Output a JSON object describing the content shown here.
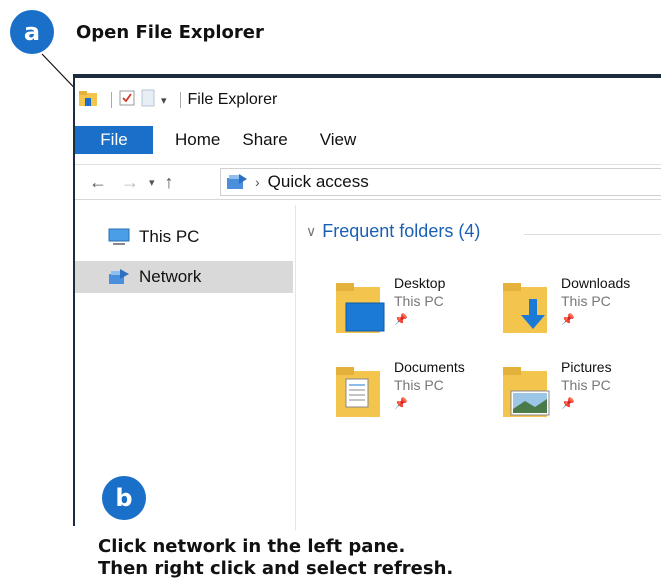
{
  "callout_a": {
    "letter": "a",
    "text": "Open File Explorer"
  },
  "callout_b": {
    "letter": "b",
    "text_line1": "Click network in the left pane.",
    "text_line2": "Then right click and select refresh."
  },
  "window": {
    "title": "File Explorer",
    "tabs": [
      "File",
      "Home",
      "Share",
      "View"
    ],
    "address": "Quick access"
  },
  "nav": {
    "items": [
      {
        "label": "This PC",
        "icon": "computer-icon"
      },
      {
        "label": "Network",
        "icon": "network-icon",
        "selected": true
      }
    ]
  },
  "content": {
    "group_title": "Frequent folders (4)",
    "folders": [
      {
        "name": "Desktop",
        "location": "This PC",
        "icon": "desktop-folder-icon"
      },
      {
        "name": "Downloads",
        "location": "This PC",
        "icon": "downloads-folder-icon"
      },
      {
        "name": "Documents",
        "location": "This PC",
        "icon": "documents-folder-icon"
      },
      {
        "name": "Pictures",
        "location": "This PC",
        "icon": "pictures-folder-icon"
      }
    ]
  },
  "colors": {
    "accent": "#1a6fc9",
    "folder": "#f3c54d",
    "selected": "#d9d9d9"
  }
}
